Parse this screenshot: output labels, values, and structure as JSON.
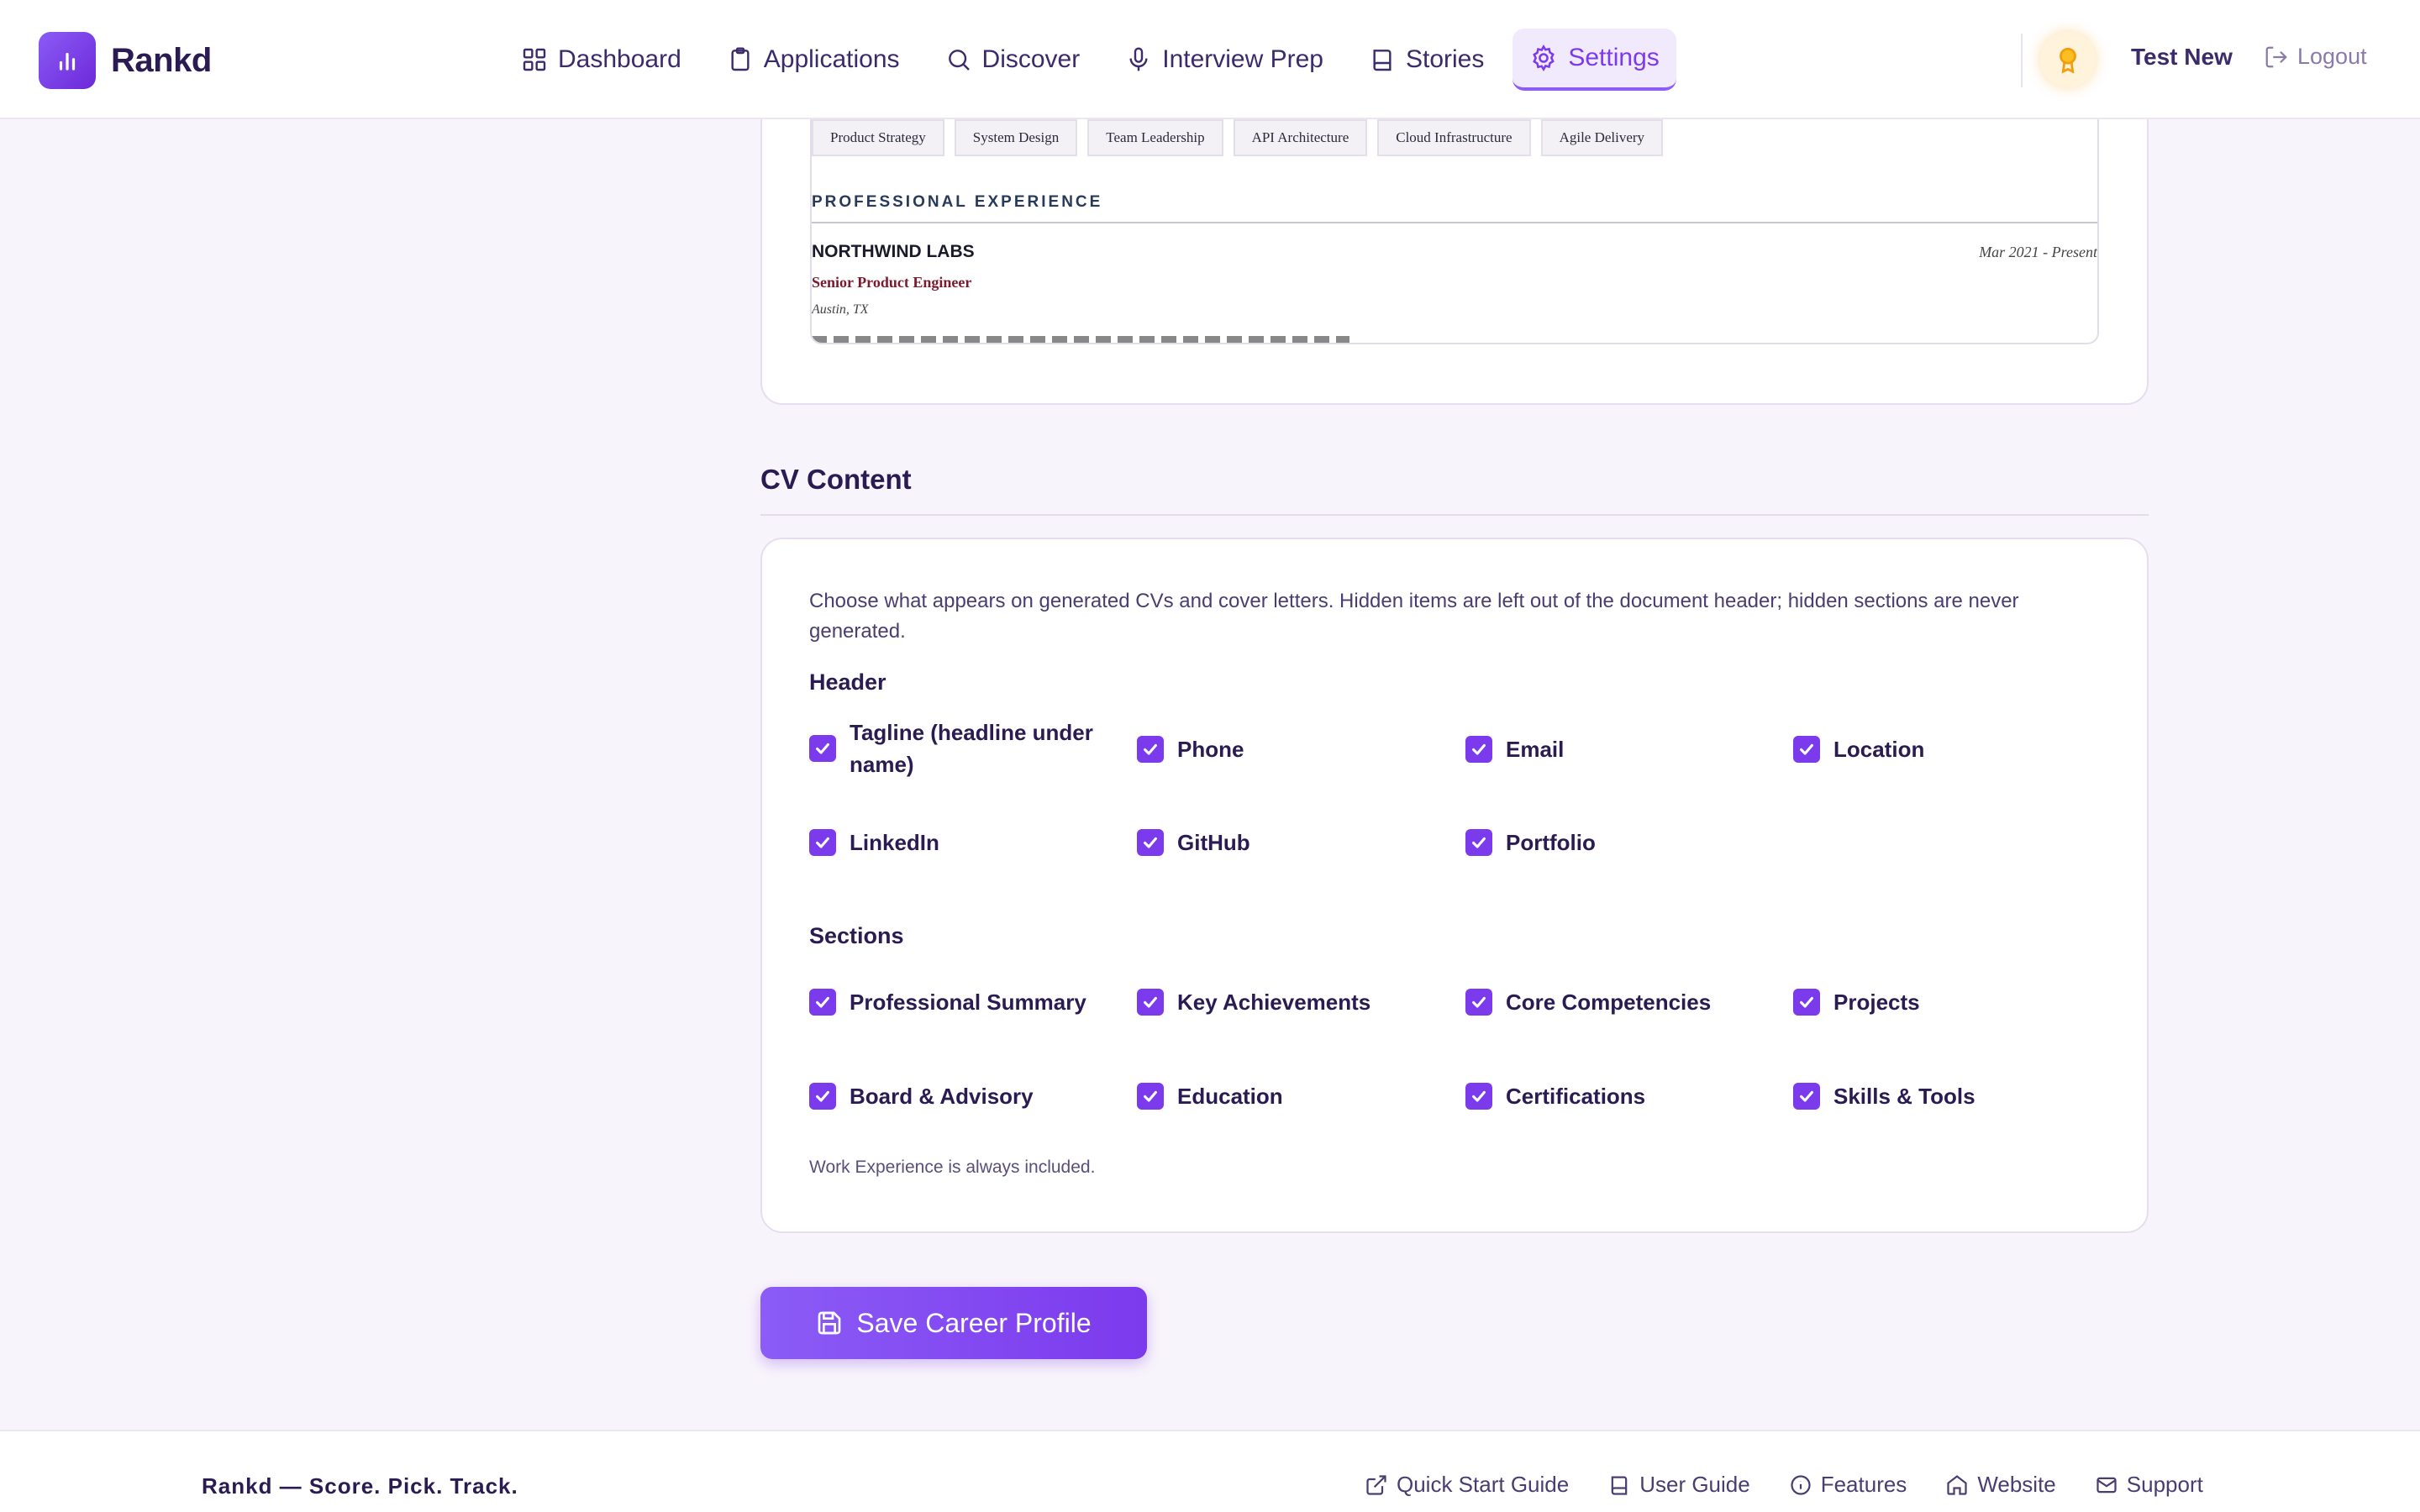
{
  "brand": {
    "name": "Rankd",
    "logo_icon": "bar-chart-icon",
    "accent": "#7c3aed"
  },
  "nav": {
    "items": [
      {
        "label": "Dashboard",
        "icon": "grid-icon",
        "active": false
      },
      {
        "label": "Applications",
        "icon": "clipboard-icon",
        "active": false
      },
      {
        "label": "Discover",
        "icon": "search-icon",
        "active": false
      },
      {
        "label": "Interview Prep",
        "icon": "microphone-icon",
        "active": false
      },
      {
        "label": "Stories",
        "icon": "book-icon",
        "active": false
      },
      {
        "label": "Settings",
        "icon": "gear-icon",
        "active": true
      }
    ]
  },
  "user": {
    "name": "Test New",
    "badge_icon": "award-icon",
    "logout_label": "Logout"
  },
  "preview": {
    "skills": [
      "Product Strategy",
      "System Design",
      "Team Leadership",
      "API Architecture",
      "Cloud Infrastructure",
      "Agile Delivery"
    ],
    "section_heading": "PROFESSIONAL EXPERIENCE",
    "company": "NORTHWIND LABS",
    "dates": "Mar 2021 - Present",
    "role": "Senior Product Engineer",
    "location": "Austin, TX"
  },
  "cv_content": {
    "title": "CV Content",
    "description": "Choose what appears on generated CVs and cover letters. Hidden items are left out of the document header; hidden sections are never generated.",
    "header_label": "Header",
    "header_items": [
      {
        "label": "Tagline (headline under name)",
        "checked": true
      },
      {
        "label": "Phone",
        "checked": true
      },
      {
        "label": "Email",
        "checked": true
      },
      {
        "label": "Location",
        "checked": true
      },
      {
        "label": "LinkedIn",
        "checked": true
      },
      {
        "label": "GitHub",
        "checked": true
      },
      {
        "label": "Portfolio",
        "checked": true
      }
    ],
    "sections_label": "Sections",
    "section_items": [
      {
        "label": "Professional Summary",
        "checked": true
      },
      {
        "label": "Key Achievements",
        "checked": true
      },
      {
        "label": "Core Competencies",
        "checked": true
      },
      {
        "label": "Projects",
        "checked": true
      },
      {
        "label": "Board & Advisory",
        "checked": true
      },
      {
        "label": "Education",
        "checked": true
      },
      {
        "label": "Certifications",
        "checked": true
      },
      {
        "label": "Skills & Tools",
        "checked": true
      }
    ],
    "note": "Work Experience is always included."
  },
  "save_button": {
    "label": "Save Career Profile",
    "icon": "floppy-disk-icon"
  },
  "footer": {
    "tagline": "Rankd — Score. Pick. Track.",
    "links": [
      {
        "label": "Quick Start Guide",
        "icon": "external-link-icon"
      },
      {
        "label": "User Guide",
        "icon": "book-icon"
      },
      {
        "label": "Features",
        "icon": "info-icon"
      },
      {
        "label": "Website",
        "icon": "home-icon"
      },
      {
        "label": "Support",
        "icon": "mail-icon"
      }
    ]
  }
}
